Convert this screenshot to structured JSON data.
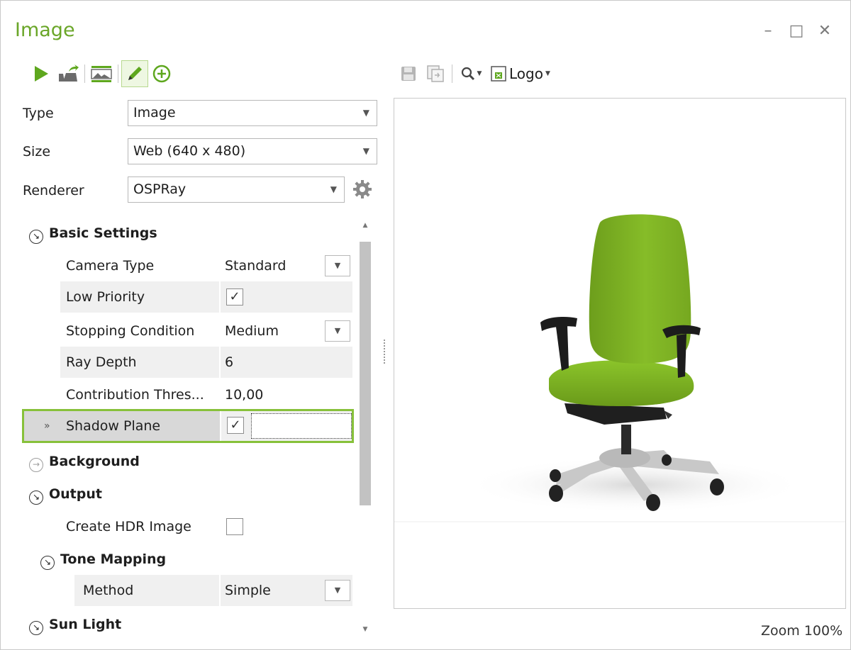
{
  "window": {
    "title": "Image",
    "controls": {
      "minimize": "–",
      "maximize": "□",
      "close": "✕"
    }
  },
  "colors": {
    "accent": "#6aa628",
    "selection_border": "#87c13a",
    "chair_green": "#7fb521"
  },
  "toolbar_left": {
    "buttons": [
      "play-icon",
      "export-icon",
      "image-settings-icon",
      "edit-pencil-icon",
      "add-circle-icon"
    ]
  },
  "fields": {
    "type": {
      "label": "Type",
      "value": "Image"
    },
    "size": {
      "label": "Size",
      "value": "Web (640 x 480)"
    },
    "renderer": {
      "label": "Renderer",
      "value": "OSPRay"
    }
  },
  "sections": {
    "basic": {
      "title": "Basic Settings"
    },
    "background": {
      "title": "Background"
    },
    "output": {
      "title": "Output"
    },
    "tone": {
      "title": "Tone Mapping"
    },
    "sun": {
      "title": "Sun Light"
    }
  },
  "properties": {
    "camera_type": {
      "label": "Camera Type",
      "value": "Standard"
    },
    "low_priority": {
      "label": "Low Priority",
      "checked": true
    },
    "stopping_condition": {
      "label": "Stopping Condition",
      "value": "Medium"
    },
    "ray_depth": {
      "label": "Ray Depth",
      "value": "6"
    },
    "contribution": {
      "label": "Contribution Thres...",
      "value": "10,00"
    },
    "shadow_plane": {
      "label": "Shadow Plane",
      "checked": true
    },
    "create_hdr": {
      "label": "Create HDR Image",
      "checked": false
    },
    "method": {
      "label": "Method",
      "value": "Simple"
    }
  },
  "glyphs": {
    "check": "✓",
    "dropdown": "▼",
    "expanded": "↘",
    "collapsed": "→",
    "current": "»"
  },
  "toolbar_right": {
    "logo_label": "Logo"
  },
  "status": {
    "zoom": "Zoom 100%"
  }
}
